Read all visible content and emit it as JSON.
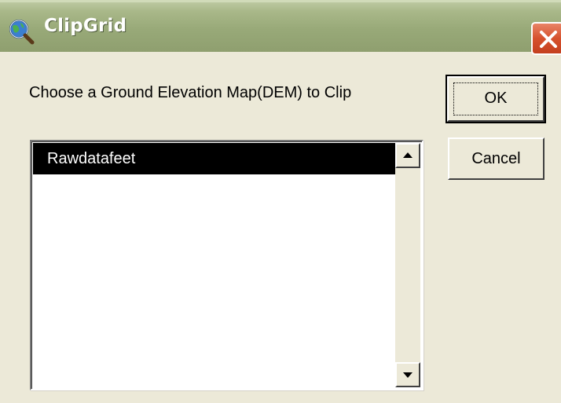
{
  "window": {
    "title": "ClipGrid",
    "icon": "globe-magnifier-icon",
    "close_icon": "close-icon"
  },
  "dialog": {
    "prompt": "Choose a Ground Elevation Map(DEM) to Clip",
    "list": {
      "items": [
        {
          "label": "Rawdatafeet",
          "selected": true
        }
      ],
      "scroll_up_icon": "scroll-up-arrow-icon",
      "scroll_down_icon": "scroll-down-arrow-icon"
    },
    "buttons": {
      "ok_label": "OK",
      "cancel_label": "Cancel"
    }
  },
  "colors": {
    "titlebar": "#98a978",
    "close_button": "#d6512d",
    "selection_bg": "#000000",
    "dialog_bg": "#ece9d8"
  }
}
